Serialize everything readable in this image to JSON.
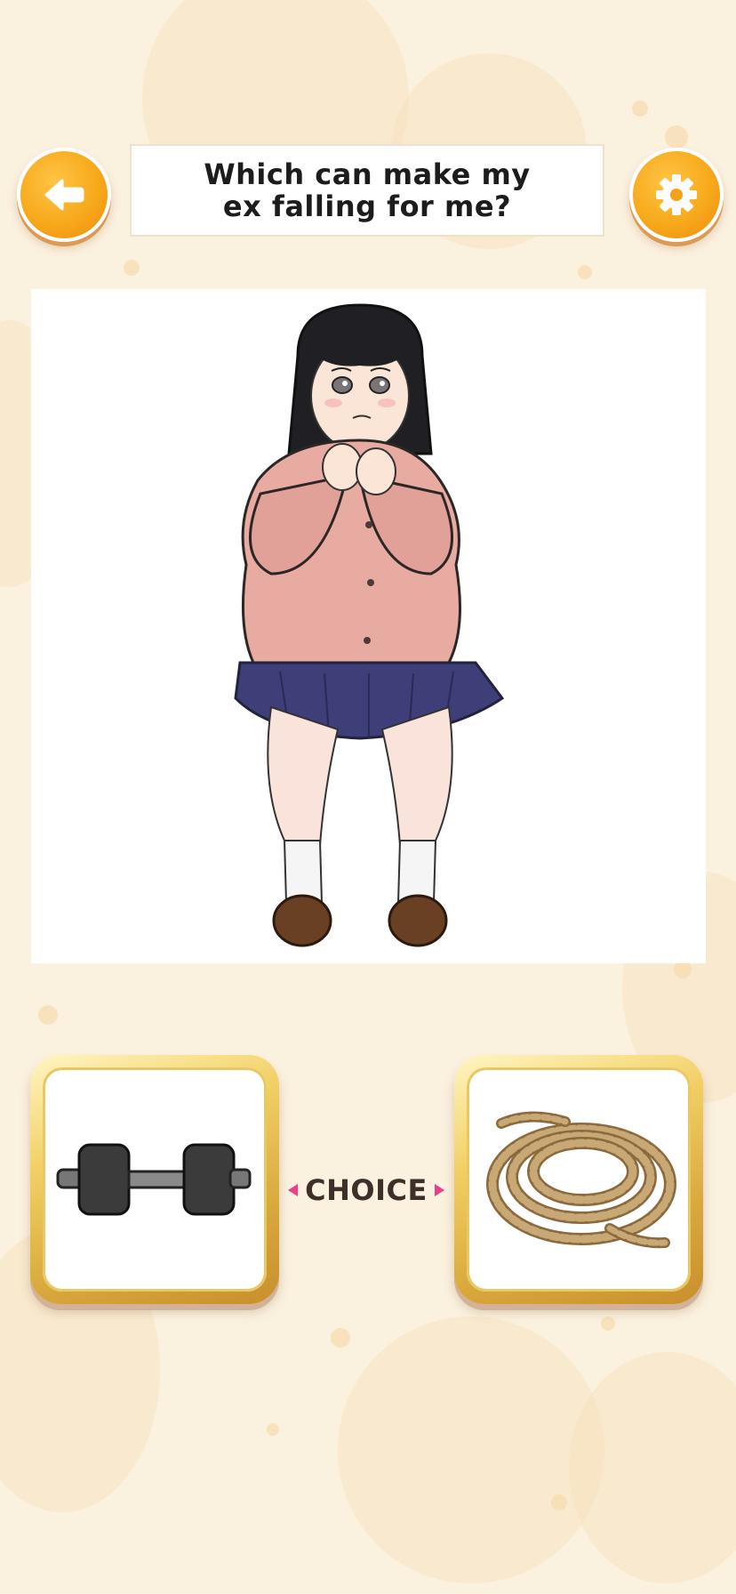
{
  "header": {
    "back_icon": "arrow-left-icon",
    "settings_icon": "gear-icon",
    "question": "Which can make my ex falling for me?"
  },
  "scene": {
    "illustration": "crying-girl-in-school-uniform"
  },
  "choices": {
    "label": "CHOICE",
    "left_option": "dumbbell",
    "right_option": "rope"
  },
  "colors": {
    "background": "#fbf1df",
    "button_orange": "#f7a91b",
    "card_gold": "#e9c863",
    "choice_arrow": "#ea3e8d",
    "choice_text": "#3d2f2a"
  }
}
